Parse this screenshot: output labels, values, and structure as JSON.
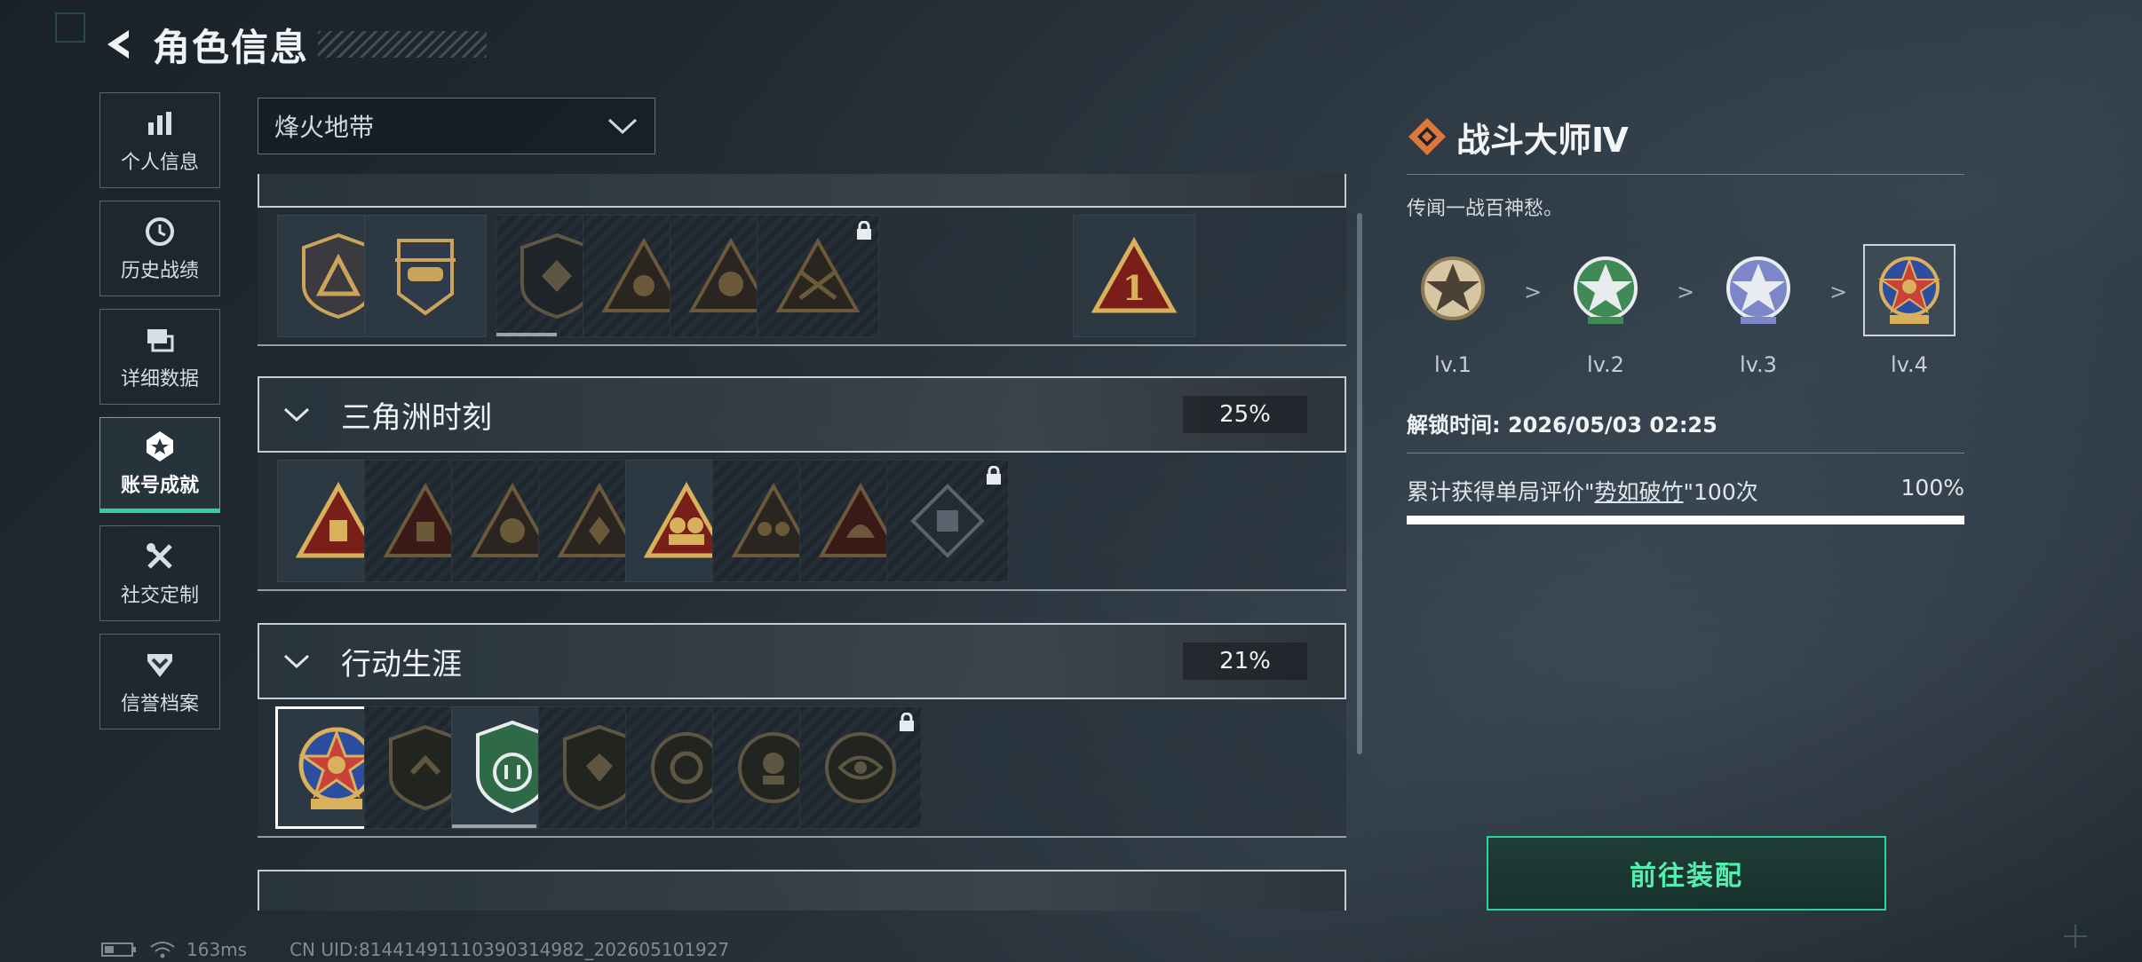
{
  "header": {
    "title": "角色信息"
  },
  "sidebar": {
    "items": [
      {
        "label": "个人信息",
        "icon": "bar-chart-icon"
      },
      {
        "label": "历史战绩",
        "icon": "history-icon"
      },
      {
        "label": "详细数据",
        "icon": "data-cards-icon"
      },
      {
        "label": "账号成就",
        "icon": "achievement-icon",
        "active": true
      },
      {
        "label": "社交定制",
        "icon": "tools-icon"
      },
      {
        "label": "信誉档案",
        "icon": "shield-chevron-icon"
      }
    ]
  },
  "filter": {
    "selected": "烽火地带"
  },
  "sections": [
    {
      "name": "",
      "collapsed_partial": true,
      "badges": [
        {
          "locked": false
        },
        {
          "locked": false
        },
        {
          "locked": true,
          "progress": 0.5
        },
        {
          "locked": true
        },
        {
          "locked": true
        },
        {
          "locked": true
        },
        {
          "locked": false
        }
      ]
    },
    {
      "name": "三角洲时刻",
      "percent": "25%",
      "badges": [
        {
          "locked": false
        },
        {
          "locked": true
        },
        {
          "locked": true
        },
        {
          "locked": true
        },
        {
          "locked": false
        },
        {
          "locked": true
        },
        {
          "locked": true
        },
        {
          "locked": true
        }
      ]
    },
    {
      "name": "行动生涯",
      "percent": "21%",
      "badges": [
        {
          "locked": false,
          "selected": true
        },
        {
          "locked": true
        },
        {
          "locked": false,
          "progress": 0.7
        },
        {
          "locked": true
        },
        {
          "locked": true
        },
        {
          "locked": true
        },
        {
          "locked": true
        }
      ]
    }
  ],
  "detail": {
    "title": "战斗大师Ⅳ",
    "description": "传闻一战百神愁。",
    "levels": [
      {
        "label": "lv.1",
        "color": "#c9b48a"
      },
      {
        "label": "lv.2",
        "color": "#3f8a55"
      },
      {
        "label": "lv.3",
        "color": "#7d86c8"
      },
      {
        "label": "lv.4",
        "color": "#c8423a",
        "current": true
      }
    ],
    "arrow": ">",
    "unlock_label": "解锁时间: ",
    "unlock_time": "2026/05/03 02:25",
    "condition_prefix": "累计获得单局评价\"",
    "condition_highlight": "势如破竹",
    "condition_suffix": "\"100次",
    "condition_percent": "100%",
    "progress": 1.0
  },
  "equip_button": {
    "label": "前往装配"
  },
  "status_bar": {
    "ping": "163ms",
    "uid": "CN UID:81441491110390314982_202605101927"
  },
  "colors": {
    "accent": "#2fd49a",
    "gold": "#c9a45a",
    "brand_orange": "#e0763a"
  }
}
